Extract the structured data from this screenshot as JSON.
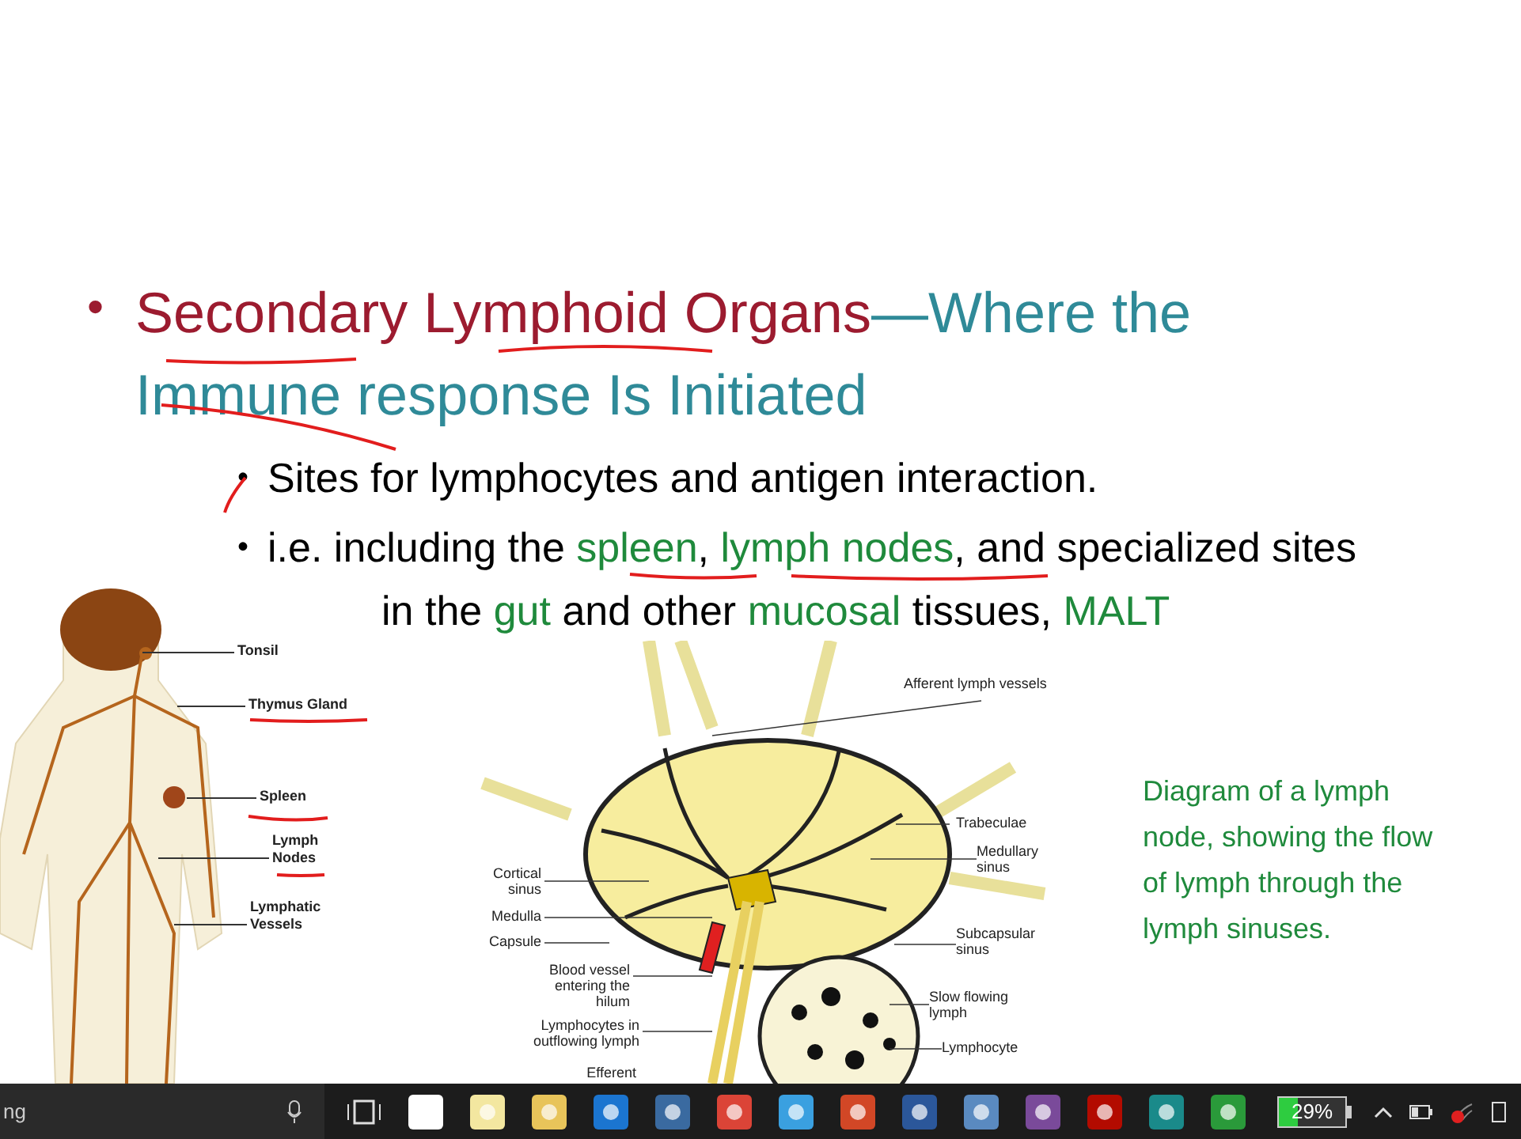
{
  "slide": {
    "bullet": "•",
    "heading": [
      {
        "kind": "title",
        "text": "Secondary Lymphoid Organs"
      },
      {
        "kind": "subtitle",
        "text": "—Where the Immune response Is Initiated"
      }
    ],
    "bullets": [
      {
        "bullet": "•",
        "segments": [
          {
            "kind": "plain",
            "text": "Sites for lymphocytes and antigen interaction."
          }
        ]
      },
      {
        "bullet": "•",
        "segments": [
          {
            "kind": "plain",
            "text": "i.e. including the "
          },
          {
            "kind": "term",
            "text": "spleen"
          },
          {
            "kind": "plain",
            "text": ", "
          },
          {
            "kind": "term",
            "text": "lymph nodes"
          },
          {
            "kind": "plain",
            "text": ", and specialized sites in the "
          },
          {
            "kind": "term",
            "text": "gut"
          },
          {
            "kind": "plain",
            "text": " and other "
          },
          {
            "kind": "term",
            "text": "mucosal"
          },
          {
            "kind": "plain",
            "text": " tissues, "
          },
          {
            "kind": "term",
            "text": "MALT"
          }
        ]
      }
    ],
    "body_figure": {
      "labels": [
        "Tonsil",
        "Thymus Gland",
        "Spleen",
        "Lymph Nodes",
        "Lymphatic Vessels"
      ]
    },
    "node_diagram": {
      "labels": [
        "Afferent lymph vessels",
        "Trabeculae",
        "Medullary sinus",
        "Subcapsular sinus",
        "Slow flowing lymph",
        "Lymphocyte",
        "Cortical sinus",
        "Medulla",
        "Capsule",
        "Blood vessel entering the hilum",
        "Lymphocytes in outflowing lymph",
        "Efferent"
      ]
    },
    "caption": "Diagram of a lymph node, showing the flow of lymph through the lymph sinuses."
  },
  "taskbar": {
    "search_text": "ng",
    "battery": {
      "reading": "29%",
      "level": 0.29
    }
  }
}
